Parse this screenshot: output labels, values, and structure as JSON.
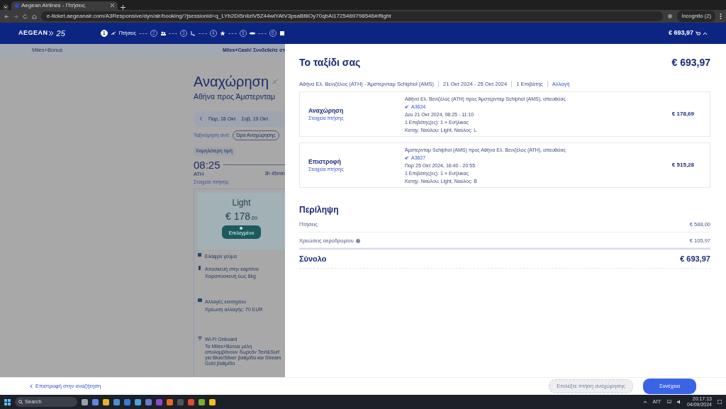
{
  "browser": {
    "tab_title": "Aegean Airlines - Πτήσεις",
    "url": "e-ticket.aegeanair.com/A3Responsive/dyn/air/booking/?jsessionid=q_LYb2DI5nIlzlV5Z44wlYAtV3psaBf8Oy70qbAl1725469798546#/flight",
    "profile": "Incognito (2)"
  },
  "header": {
    "logo": "AEGEAN",
    "anniversary": "25",
    "total": "€ 693,97",
    "steps": [
      {
        "number": "1",
        "label": "Πτήσεις",
        "selected": true
      },
      {
        "number": "2",
        "selected": false
      },
      {
        "number": "3",
        "selected": false
      },
      {
        "number": "4",
        "selected": false
      },
      {
        "number": "5",
        "selected": false
      },
      {
        "number": "6",
        "selected": false
      }
    ]
  },
  "background_page": {
    "promo_left": "Miles+Bonus",
    "promo_right": "Miles+Cash! Συνδεθείτε στ",
    "title": "Αναχώρηση",
    "subtitle": "Αθήνα προς Άμστερνταμ",
    "dates": [
      {
        "label": "Παρ, 18 Οκτ"
      },
      {
        "label": "Σαβ, 19 Οκτ"
      }
    ],
    "sort_label": "Ταξινόμηση ανά:",
    "sort_option": "Ώρα Αναχώρησης",
    "badge": "Χαμηλότερη τιμή",
    "departure_time": "08:25",
    "airport": "ATH",
    "duration": "3h 45min",
    "details_link": "Στοιχεία πτήσης",
    "fare": {
      "name": "Light",
      "price": "€ 178",
      "price_cents": ".69",
      "button": "Επιλεγμένο",
      "features": [
        {
          "label": "Ελαφρύ γεύμα"
        },
        {
          "label": "Αποσκευή στην καμπίνα",
          "note": "Χειραποσκευή έως 8kg"
        },
        {
          "label": "Αλλαγές εισιτηρίου",
          "note": "Χρέωση αλλαγής: 70 EUR"
        },
        {
          "label": "Wi-Fi Onboard",
          "note": "Τα Miles+Bonus μέλη απολαμβάνουν δωρεάν Text&Surf για Blue/Silver βαθμίδα και Stream Gold βαθμίδα"
        }
      ]
    }
  },
  "trip_panel": {
    "title": "Το ταξίδι σας",
    "total": "€ 693,97",
    "meta": [
      "Αθήνα Ελ. Βενιζέλος (ATH) - Άμστερνταμ Schiphol (AMS)",
      "21 Οκτ 2024 - 25 Οκτ 2024",
      "1 Επιβάτης"
    ],
    "change_link": "Αλλαγή",
    "flights": [
      {
        "direction": "Αναχώρηση",
        "details_link": "Στοιχεία πτήσης",
        "route": "Αθήνα Ελ. Βενιζέλος (ATH) προς Άμστερνταμ Schiphol (AMS), απευθείας",
        "flight_number": "A3624",
        "schedule": "Δευ 21 Οκτ 2024, 08:25 - 11:10",
        "passengers": "1 Επιβάτης(ες): 1 × Ενήλικας",
        "fare": "Κατηγ. Ναύλου: Light, Ναύλος: L",
        "price": "€ 178,69"
      },
      {
        "direction": "Επιστροφή",
        "details_link": "Στοιχεία πτήσης",
        "route": "Άμστερνταμ Schiphol (AMS) προς Αθήνα Ελ. Βενιζέλος (ATH), απευθείας",
        "flight_number": "A3627",
        "schedule": "Παρ 25 Οκτ 2024, 16:40 - 20:55",
        "passengers": "1 Επιβάτης(ες): 1 × Ενήλικας",
        "fare": "Κατηγ. Ναύλου: Light, Ναύλος: B",
        "price": "€ 515,28"
      }
    ],
    "summary": {
      "title": "Περίληψη",
      "rows": [
        {
          "label": "Πτήσεις",
          "value": "€ 588,00",
          "info": false
        },
        {
          "label": "Χρεώσεις αεροδρομίου",
          "value": "€ 105,97",
          "info": true
        }
      ],
      "total_label": "Σύνολο",
      "total_value": "€ 693,97"
    }
  },
  "footer": {
    "back_link": "Επιστροφή στην αναζήτηση",
    "buttons": [
      {
        "label": "Επιλέξτε πτήση αναχώρησης",
        "disabled": true
      },
      {
        "label": "Συνέχεια",
        "disabled": false
      }
    ]
  },
  "taskbar": {
    "search_placeholder": "Search",
    "language": "ΑΓΓ",
    "time": "20:17:13",
    "date": "04/09/2024"
  }
}
